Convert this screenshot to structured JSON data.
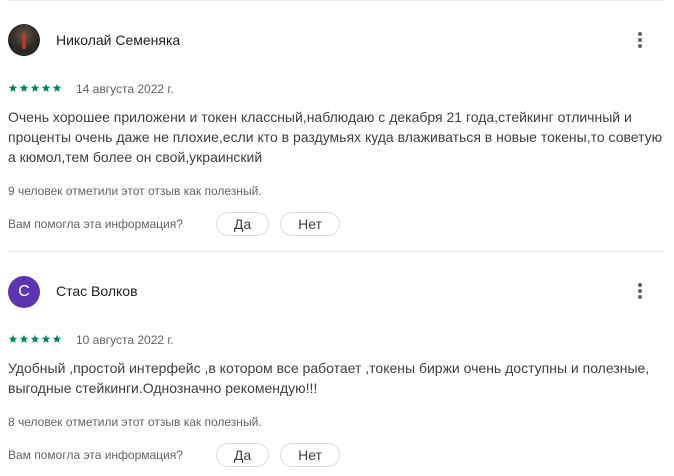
{
  "colors": {
    "star": "#01875f",
    "letter_avatar": "#5e35b1"
  },
  "reviews": [
    {
      "author": "Николай Семеняка",
      "avatar_type": "photo",
      "rating": 5,
      "date": "14 августа 2022 г.",
      "text": "Очень хорошее приложени и токен классный,наблюдаю с декабря 21 года,стейкинг отличный и проценты очень даже не плохие,если кто в раздумьях куда влаживаться в новые токены,то советую а кюмол,тем более он свой,украинский",
      "helpful": "9 человек отметили этот отзыв как полезный.",
      "question": "Вам помогла эта информация?",
      "yes_label": "Да",
      "no_label": "Нет"
    },
    {
      "author": "Стас Волков",
      "avatar_type": "letter",
      "avatar_letter": "С",
      "rating": 5,
      "date": "10 августа 2022 г.",
      "text": "Удобный ,простой интерфейс ,в котором все работает ,токены биржи очень доступны и полезные, выгодные стейкинги.Однозначно рекомендую!!!",
      "helpful": "8 человек отметили этот отзыв как полезный.",
      "question": "Вам помогла эта информация?",
      "yes_label": "Да",
      "no_label": "Нет"
    }
  ]
}
